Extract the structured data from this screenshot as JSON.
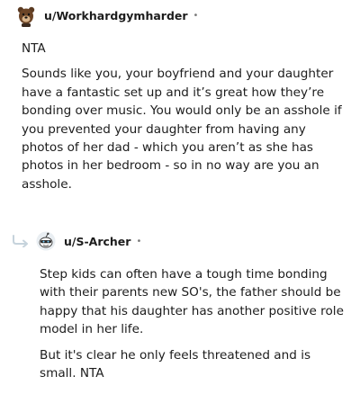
{
  "comments": [
    {
      "username": "u/Workhardgymharder",
      "separator": "•",
      "paragraphs": [
        "NTA",
        "Sounds like you, your boyfriend and your daughter have a fantastic set up and it’s great how they’re bonding over music. You would only be an asshole if you prevented your daughter from having any photos of her dad - which you aren’t as she has photos in her bedroom - so in no way are you an asshole."
      ]
    },
    {
      "username": "u/S-Archer",
      "separator": "•",
      "paragraphs": [
        "Step kids can often have a tough time bonding with their parents new SO's, the father should be happy that his daughter has another positive role model in her life.",
        "But it's clear he only feels threatened and is small. NTA"
      ]
    }
  ],
  "colors": {
    "text": "#1c1c1c",
    "muted": "#7c7c7c",
    "reply_arrow": "#c6d3dc"
  }
}
